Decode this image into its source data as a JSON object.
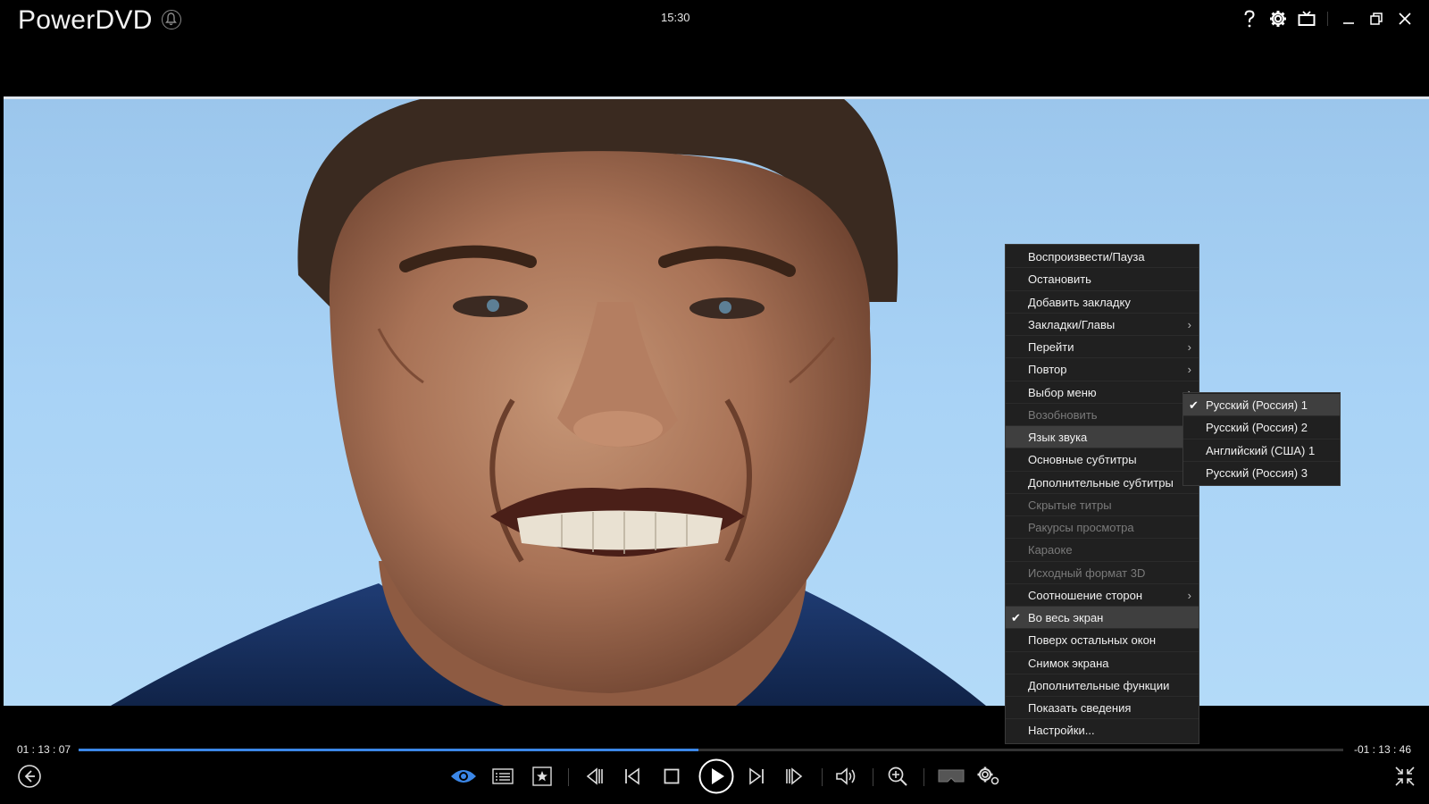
{
  "app": {
    "title": "PowerDVD",
    "clock": "15:30"
  },
  "colors": {
    "accent": "#3b87e8",
    "menu_bg": "#202020",
    "menu_highlight": "#3f3f3f"
  },
  "menu": {
    "items": [
      {
        "label": "Воспроизвести/Пауза",
        "enabled": true
      },
      {
        "label": "Остановить",
        "enabled": true
      },
      {
        "label": "Добавить закладку",
        "enabled": true
      },
      {
        "label": "Закладки/Главы",
        "enabled": true,
        "submenu": true
      },
      {
        "label": "Перейти",
        "enabled": true,
        "submenu": true
      },
      {
        "label": "Повтор",
        "enabled": true,
        "submenu": true
      },
      {
        "label": "Выбор меню",
        "enabled": true,
        "submenu": true
      },
      {
        "label": "Возобновить",
        "enabled": false
      },
      {
        "label": "Язык звука",
        "enabled": true,
        "highlighted": true,
        "submenu": true
      },
      {
        "label": "Основные субтитры",
        "enabled": true,
        "submenu": true
      },
      {
        "label": "Дополнительные субтитры",
        "enabled": true,
        "submenu": true
      },
      {
        "label": "Скрытые титры",
        "enabled": false
      },
      {
        "label": "Ракурсы просмотра",
        "enabled": false
      },
      {
        "label": "Караоке",
        "enabled": false
      },
      {
        "label": "Исходный формат 3D",
        "enabled": false
      },
      {
        "label": "Соотношение сторон",
        "enabled": true,
        "submenu": true
      },
      {
        "label": "Во весь экран",
        "enabled": true,
        "checked": true,
        "highlighted": true
      },
      {
        "label": "Поверх остальных окон",
        "enabled": true
      },
      {
        "label": "Снимок экрана",
        "enabled": true
      },
      {
        "label": "Дополнительные функции",
        "enabled": true
      },
      {
        "label": "Показать сведения",
        "enabled": true
      },
      {
        "label": "Настройки...",
        "enabled": true
      }
    ]
  },
  "audio_submenu": {
    "items": [
      {
        "label": "Русский (Россия) 1",
        "checked": true,
        "highlighted": true
      },
      {
        "label": "Русский (Россия) 2",
        "checked": false
      },
      {
        "label": "Английский (США) 1",
        "checked": false
      },
      {
        "label": "Русский (Россия) 3",
        "checked": false
      }
    ]
  },
  "playback": {
    "elapsed": "01 : 13 : 07",
    "remaining": "-01 : 13 : 46",
    "progress_fraction": 0.49
  }
}
